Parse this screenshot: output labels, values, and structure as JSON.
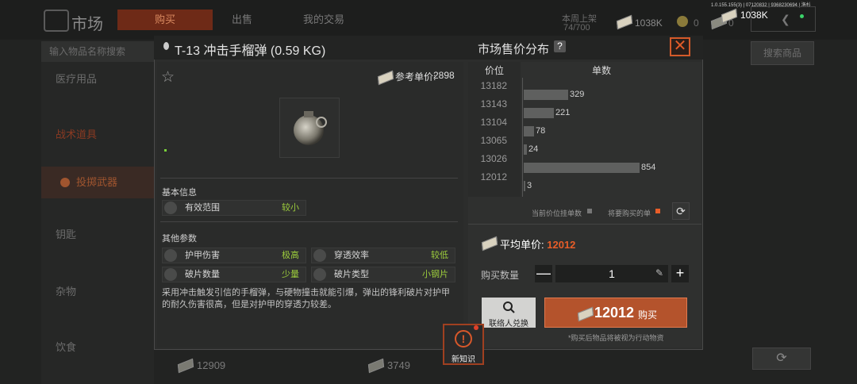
{
  "version": "1.0.155.155(3) | 07120832 | 9368230694 | 洛杉",
  "topbar": {
    "title": "市场",
    "tabs": [
      "购买",
      "出售",
      "我的交易"
    ],
    "listing_label": "本周上架",
    "listing_value": "74/700",
    "money": "1038K",
    "count1": "0",
    "count2": "0",
    "wallet": "1038K"
  },
  "sidebar": {
    "search_placeholder": "输入物品名称搜索",
    "categories": [
      "医疗用品",
      "战术道具",
      "投掷武器",
      "钥匙",
      "杂物",
      "饮食"
    ]
  },
  "search_button": "搜索商品",
  "bottom_prices": [
    "12909",
    "3749"
  ],
  "item": {
    "title": "T-13 冲击手榴弹 (0.59 KG)",
    "ref_price_label": "参考单价:",
    "ref_price": "2898",
    "basic_info_label": "基本信息",
    "basic": [
      {
        "k": "有效范围",
        "v": "较小"
      }
    ],
    "other_params_label": "其他参数",
    "params": [
      {
        "k": "护甲伤害",
        "v": "极高"
      },
      {
        "k": "穿透效率",
        "v": "较低"
      },
      {
        "k": "破片数量",
        "v": "少量"
      },
      {
        "k": "破片类型",
        "v": "小钢片"
      }
    ],
    "description": "采用冲击触发引信的手榴弹，与硬物撞击就能引爆，弹出的锋利破片对护甲的耐久伤害很高，但是对护甲的穿透力较差。"
  },
  "distribution": {
    "title": "市场售价分布",
    "help": "?",
    "close": "✕",
    "col_price": "价位",
    "col_count": "单数",
    "legend_current": "当前价位挂单数",
    "legend_buy": "将要购买的单"
  },
  "chart_data": {
    "type": "bar",
    "orientation": "horizontal",
    "categories": [
      "13182",
      "13143",
      "13104",
      "13065",
      "13026",
      "12012"
    ],
    "values": [
      329,
      221,
      78,
      24,
      854,
      3
    ],
    "row_labels": [
      "",
      "329",
      "221",
      "78",
      "24",
      "854",
      "3"
    ],
    "xlabel": "单数",
    "ylabel": "价位",
    "colors": {
      "bar": "#5f605f",
      "buy": "#e85d28"
    }
  },
  "purchase": {
    "avg_label": "平均单价:",
    "avg_value": "12012",
    "qty_label": "购买数量",
    "qty_value": "1",
    "minus": "—",
    "plus": "+",
    "contact_label": "联络人兑换",
    "buy_price": "12012",
    "buy_label": "购买",
    "note": "*购买后物品将被视为行动物资"
  },
  "knowledge": {
    "label": "新知识",
    "icon_text": "!"
  }
}
